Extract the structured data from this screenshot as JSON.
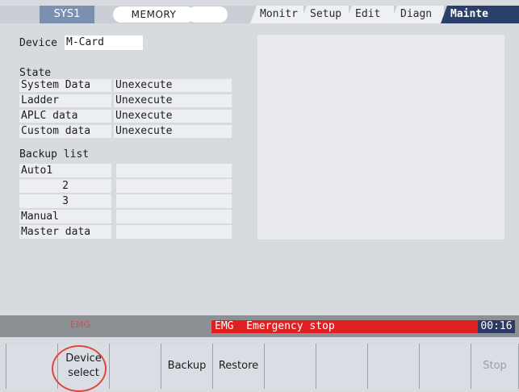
{
  "header": {
    "system": "SYS1",
    "mode": "MEMORY",
    "tabs": [
      "Monitr",
      "Setup",
      "Edit",
      "Diagn",
      "Mainte"
    ],
    "active_tab": "Mainte"
  },
  "device": {
    "label": "Device",
    "value": "M-Card"
  },
  "state": {
    "title": "State",
    "rows": [
      {
        "label": "System Data",
        "value": "Unexecute"
      },
      {
        "label": "Ladder",
        "value": "Unexecute"
      },
      {
        "label": "APLC data",
        "value": "Unexecute"
      },
      {
        "label": "Custom data",
        "value": "Unexecute"
      }
    ]
  },
  "backup_list": {
    "title": "Backup list",
    "rows": [
      {
        "label": "Auto1",
        "value": ""
      },
      {
        "label": "2",
        "value": ""
      },
      {
        "label": "3",
        "value": ""
      },
      {
        "label": "Manual",
        "value": ""
      },
      {
        "label": "Master data",
        "value": ""
      }
    ]
  },
  "status": {
    "emg_indicator": "EMG",
    "alarm_code": "EMG",
    "alarm_text": "Emergency stop",
    "time": "00:16",
    "alarm_color": "#e02020"
  },
  "softkeys": [
    {
      "label": "",
      "enabled": false
    },
    {
      "label": "Device select",
      "enabled": true,
      "highlighted": true
    },
    {
      "label": "",
      "enabled": false
    },
    {
      "label": "Backup",
      "enabled": true
    },
    {
      "label": "Restore",
      "enabled": true
    },
    {
      "label": "",
      "enabled": false
    },
    {
      "label": "",
      "enabled": false
    },
    {
      "label": "",
      "enabled": false
    },
    {
      "label": "",
      "enabled": false
    },
    {
      "label": "Stop",
      "enabled": false
    }
  ]
}
